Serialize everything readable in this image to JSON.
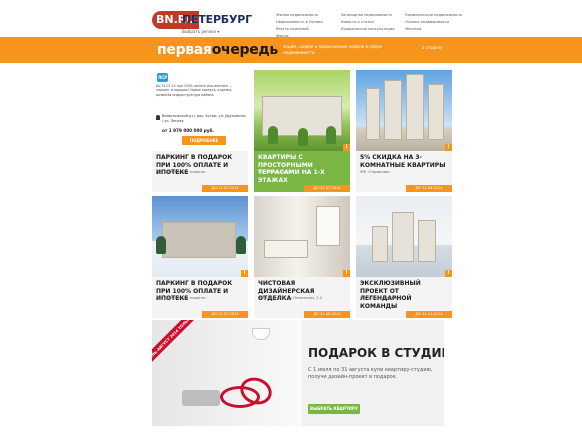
{
  "header": {
    "logo_brand": "BN.RU",
    "logo_city": "ПЕТЕРБУРГ",
    "logo_sub": "Выбрать регион ▾",
    "top_links": [
      "Жилая недвижимость",
      "Загородная недвижимость",
      "Коммерческая недвижимость",
      "Недвижимость в Латвии",
      "Новости и статьи",
      "Оценка недвижимости",
      "Реестр компаний",
      "Юридическая консультация",
      "Ипотека",
      "Форум"
    ]
  },
  "orange_bar": {
    "brand_thin": "первая",
    "brand_bold": "очередь",
    "tagline": "акции, скидки и предложения недели в сфере недвижимости",
    "share": "в сторону"
  },
  "tiles": [
    {
      "title": "ПАРКИНГ В ПОДАРОК ПРИ 100% ОПЛАТЕ И ИПОТЕКЕ",
      "company": "ЖК «Зеленоград тишина»",
      "date": "ДО 31.07.2014",
      "info_text": "До 31.07.14 при 100% оплате или ипотеке — паркинг в подарок! Новые корпуса, отделка, развитая инфраструктура района.",
      "address": "Всеволожский р-н, дер. Бугры, ул. Дружинная / ул. Лесная",
      "price": "от 1 979 000 000 руб.",
      "more": "ПОДРОБНЕЕ",
      "badge": "ЛСР"
    },
    {
      "title": "КВАРТИРЫ С ПРОСТОРНЫМИ ТЕРРАСАМИ НА 1-Х ЭТАЖАХ",
      "company": "ЖК «Солнечный»",
      "date": "ДО 31.07.2014"
    },
    {
      "title": "5% СКИДКА НА 3-КОМНАТНЫЕ КВАРТИРЫ",
      "company": "ЖК «Гармония»",
      "date": "ДО 31.08.2014"
    },
    {
      "title": "ПАРКИНГ В ПОДАРОК ПРИ 100% ОПЛАТЕ И ИПОТЕКЕ",
      "company": "ЖК «Зеленоград тишина»",
      "date": "ДО 31.07.2014"
    },
    {
      "title": "ЧИСТОВАЯ ДИЗАЙНЕРСКАЯ ОТДЕЛКА",
      "company": "ЖК «Легенда» на Ленинском, 2-4",
      "date": "ДО 31.08.2014"
    },
    {
      "title": "ЭКСКЛЮЗИВНЫЙ ПРОЕКТ ОТ ЛЕГЕНДАРНОЙ КОМАНДЫ",
      "company": "ЖК «Ленинский мыс»",
      "date": "ДО 31.12.2014"
    }
  ],
  "banner": {
    "ribbon": "ИЮЛЬ–АВГУСТ 2014 ТОЛЬКО",
    "heading": "ПОДАРОК В СТУДИЮ!",
    "text": "С 1 июля по 31 августа купи квартиру-студию, получи дизайн-проект в подарок.",
    "button": "ВЫБРАТЬ КВАРТИРУ"
  },
  "colors": {
    "accent": "#f7941d",
    "green": "#7ab643",
    "dark_text": "#1a1a1a",
    "red": "#c8102e"
  }
}
